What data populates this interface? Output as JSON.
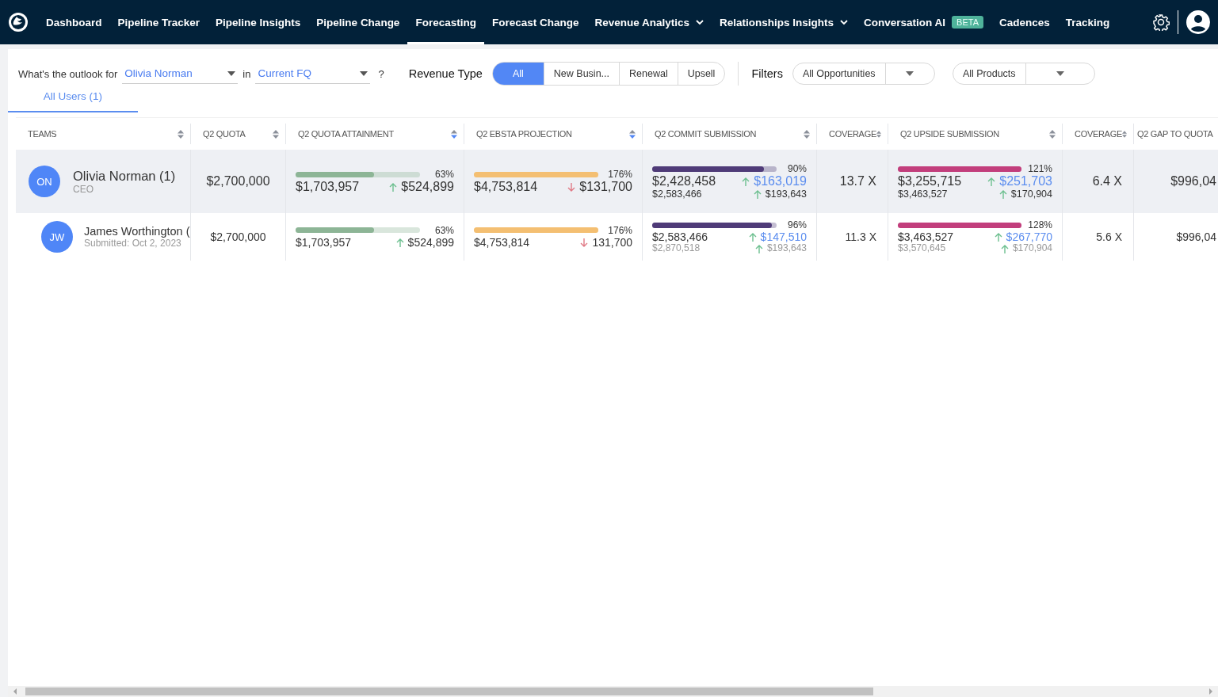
{
  "nav": {
    "items": [
      {
        "label": "Dashboard",
        "selected": false,
        "dropdown": false
      },
      {
        "label": "Pipeline Tracker",
        "selected": false,
        "dropdown": false
      },
      {
        "label": "Pipeline Insights",
        "selected": false,
        "dropdown": false
      },
      {
        "label": "Pipeline Change",
        "selected": false,
        "dropdown": false
      },
      {
        "label": "Forecasting",
        "selected": true,
        "dropdown": false
      },
      {
        "label": "Forecast Change",
        "selected": false,
        "dropdown": false
      },
      {
        "label": "Revenue Analytics",
        "selected": false,
        "dropdown": true
      },
      {
        "label": "Relationships Insights",
        "selected": false,
        "dropdown": true
      },
      {
        "label": "Conversation AI",
        "selected": false,
        "dropdown": false,
        "badge": "BETA"
      },
      {
        "label": "Cadences",
        "selected": false,
        "dropdown": false
      },
      {
        "label": "Tracking",
        "selected": false,
        "dropdown": false
      }
    ]
  },
  "outlook": {
    "label": "What's the outlook for",
    "person": "Olivia Norman",
    "in_label": "in",
    "period": "Current FQ",
    "help": "?"
  },
  "revenue_type": {
    "label": "Revenue Type",
    "options": [
      {
        "label": "All",
        "selected": true
      },
      {
        "label": "New Busin...",
        "selected": false
      },
      {
        "label": "Renewal",
        "selected": false
      },
      {
        "label": "Upsell",
        "selected": false
      }
    ]
  },
  "filters": {
    "label": "Filters",
    "dropdowns": [
      "All Opportunities",
      "All Products"
    ]
  },
  "tabs": [
    {
      "label": "All Users (1)",
      "selected": true
    }
  ],
  "table": {
    "columns": [
      {
        "label": "TEAMS",
        "kind": "team",
        "sorted": false
      },
      {
        "label": "Q2 QUOTA",
        "kind": "money",
        "sorted": false
      },
      {
        "label": "Q2 QUOTA ATTAINMENT",
        "kind": "bar",
        "sorted": true,
        "color": "#8db596"
      },
      {
        "label": "Q2 EBSTA PROJECTION",
        "kind": "bar",
        "sorted": true,
        "color": "#f4bf72"
      },
      {
        "label": "Q2 COMMIT SUBMISSION",
        "kind": "submission",
        "sorted": false,
        "color": "#4f3b78"
      },
      {
        "label": "COVERAGE",
        "kind": "ratio",
        "sorted": false
      },
      {
        "label": "Q2 UPSIDE SUBMISSION",
        "kind": "submission",
        "sorted": false,
        "color": "#c23e7c"
      },
      {
        "label": "COVERAGE",
        "kind": "ratio",
        "sorted": false
      },
      {
        "label": "Q2 GAP TO QUOTA",
        "kind": "money"
      }
    ],
    "rows": [
      {
        "kind": "summary",
        "cells": [
          {
            "initials": "ON",
            "name": "Olivia Norman (1)",
            "subtitle": "CEO"
          },
          {
            "value": "$2,700,000"
          },
          {
            "level": 0.63,
            "percent": "63%",
            "value": "$1,703,957",
            "delta": "$524,899",
            "rising": true
          },
          {
            "level": 1,
            "percent": "176%",
            "value": "$4,753,814",
            "delta": "$131,700",
            "rising": false
          },
          {
            "level": 0.9,
            "percent": "90%",
            "value": "$2,428,458",
            "delta": "$163,019",
            "rising": true,
            "sub_value": "$2,583,466",
            "sub_delta": "$193,643",
            "sub_rising": true
          },
          {
            "value": "13.7 X"
          },
          {
            "level": 1,
            "percent": "121%",
            "value": "$3,255,715",
            "delta": "$251,703",
            "rising": true,
            "sub_value": "$3,463,527",
            "sub_delta": "$170,904",
            "sub_rising": true
          },
          {
            "value": "6.4 X"
          },
          {
            "value": "$996,04"
          }
        ]
      },
      {
        "kind": "member",
        "cells": [
          {
            "initials": "JW",
            "name": "James Worthington (",
            "subtitle": "Submitted: Oct 2, 2023"
          },
          {
            "value": "$2,700,000"
          },
          {
            "level": 0.63,
            "percent": "63%",
            "value": "$1,703,957",
            "delta": "$524,899",
            "rising": true
          },
          {
            "level": 1,
            "percent": "176%",
            "value": "$4,753,814",
            "delta": "131,700",
            "rising": false
          },
          {
            "level": 0.96,
            "percent": "96%",
            "value": "$2,583,466",
            "delta": "$147,510",
            "rising": true,
            "sub_value": "$2,870,518",
            "sub_delta": "$193,643",
            "sub_rising": true
          },
          {
            "value": "11.3 X"
          },
          {
            "level": 1,
            "percent": "128%",
            "value": "$3,463,527",
            "delta": "$267,770",
            "rising": true,
            "sub_value": "$3,570,645",
            "sub_delta": "$170,904",
            "sub_rising": true
          },
          {
            "value": "5.6 X"
          },
          {
            "value": "$996,04"
          }
        ]
      }
    ]
  }
}
